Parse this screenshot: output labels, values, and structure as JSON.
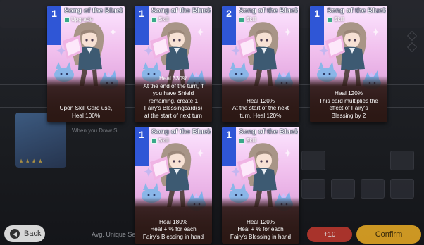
{
  "screen": {
    "background_hint_label": "When you Draw S...",
    "bottom_hint": "Avg. Unique Se...",
    "back_label": "Back",
    "red_button_label": "+10",
    "gold_button_label": "Confirm"
  },
  "colors": {
    "cost_blue": "#2f56d6",
    "card_pink": "#f2c3ef",
    "footer_dark": "#2c1814",
    "type_green": "#3aa88a"
  },
  "cards": [
    {
      "cost": "1",
      "title": "Song of the Bluebi",
      "type_label": "Upgrade",
      "desc": [
        "Upon Skill Card use,",
        "Heal 100%"
      ]
    },
    {
      "cost": "1",
      "title": "Song of the Bluebi",
      "type_label": "Skill",
      "desc": [
        "Heal 330%",
        "At the end of the turn, if",
        "you have Shield",
        "remaining, create 1",
        "Fairy's Blessingcard(s)",
        "at the start of next turn"
      ]
    },
    {
      "cost": "2",
      "title": "Song of the Bluebi",
      "type_label": "Skill",
      "desc": [
        "Heal 120%",
        "At the start of the next",
        "turn, Heal 120%"
      ]
    },
    {
      "cost": "1",
      "title": "Song of the Bluebi",
      "type_label": "Skill",
      "desc": [
        "Heal 120%",
        "This card multiplies the",
        "effect of Fairy's",
        "Blessing by 2"
      ]
    },
    {
      "cost": "1",
      "title": "Song of the Bluebi",
      "type_label": "Skill",
      "desc": [
        "Heal 180%",
        "Heal + % for each",
        "Fairy's Blessing in hand"
      ]
    },
    {
      "cost": "1",
      "title": "Song of the Bluebi",
      "type_label": "Skill",
      "desc": [
        "Heal 120%",
        "Heal + % for each",
        "Fairy's Blessing in hand"
      ]
    }
  ]
}
